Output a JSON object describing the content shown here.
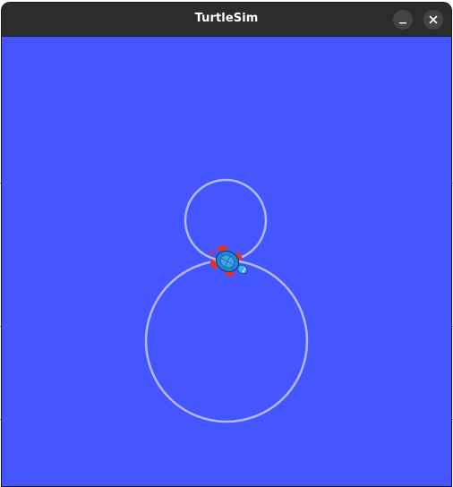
{
  "window": {
    "title": "TurtleSim",
    "minimize_icon": "minimize-icon",
    "close_icon": "close-icon"
  },
  "canvas": {
    "background_color": "#4556ff",
    "trail_color": "#b3b8ff",
    "turtle_icon": "turtle-icon"
  }
}
